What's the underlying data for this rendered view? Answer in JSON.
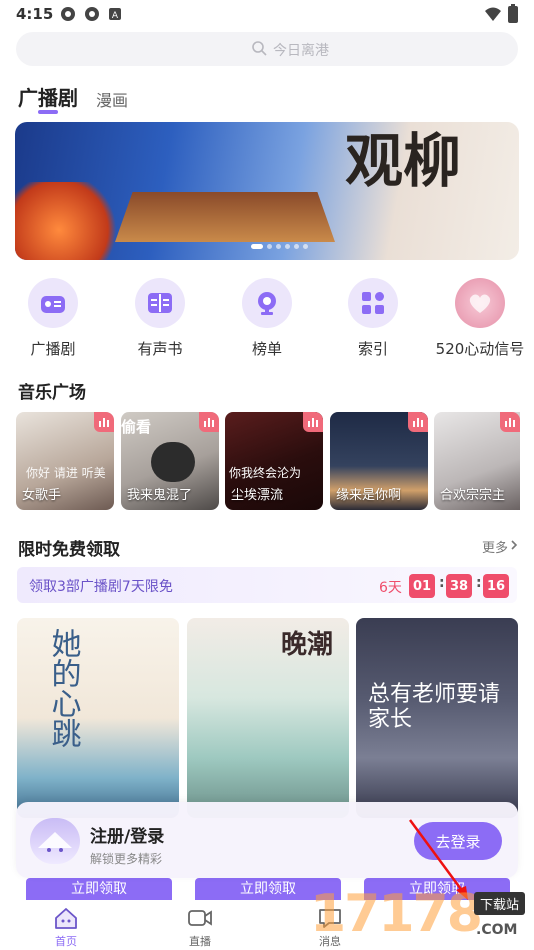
{
  "status": {
    "time": "4:15"
  },
  "search": {
    "placeholder": "今日离港"
  },
  "tabs": [
    {
      "label": "广播剧"
    },
    {
      "label": "漫画"
    }
  ],
  "banner": {
    "calligraphy": "观柳"
  },
  "categories": [
    {
      "label": "广播剧",
      "icon": "radio-icon"
    },
    {
      "label": "有声书",
      "icon": "book-icon"
    },
    {
      "label": "榜单",
      "icon": "trophy-icon"
    },
    {
      "label": "索引",
      "icon": "grid-icon"
    },
    {
      "label": "520心动信号",
      "icon": "heart-signal-icon"
    }
  ],
  "music": {
    "title": "音乐广场",
    "items": [
      {
        "caption": "女歌手",
        "overlay": "你好 请进 听美"
      },
      {
        "caption": "我来鬼混了",
        "overlay": "偷看"
      },
      {
        "caption": "尘埃漂流",
        "overlay": "你我终会沦为"
      },
      {
        "caption": "缘来是你啊",
        "overlay": ""
      },
      {
        "caption": "合欢宗宗主",
        "overlay": ""
      }
    ]
  },
  "free": {
    "title": "限时免费领取",
    "more": "更多",
    "promo": "领取3部广播剧7天限免",
    "days": "6天",
    "hours": "01",
    "minutes": "38",
    "seconds": "16",
    "claim": "立即领取",
    "books": [
      {
        "title": "她的心跳"
      },
      {
        "title": "晚潮"
      },
      {
        "title": "总有老师要请家长"
      }
    ]
  },
  "login": {
    "title": "注册/登录",
    "subtitle": "解锁更多精彩",
    "button": "去登录"
  },
  "tabbar": [
    {
      "label": "首页"
    },
    {
      "label": "直播"
    },
    {
      "label": "消息"
    }
  ],
  "watermark": {
    "number": "17178",
    "download": "下载站",
    "domain": ".COM"
  },
  "colors": {
    "accent": "#8c6cf5",
    "countdown": "#ef4d6b",
    "tag": "#f06a7a"
  }
}
